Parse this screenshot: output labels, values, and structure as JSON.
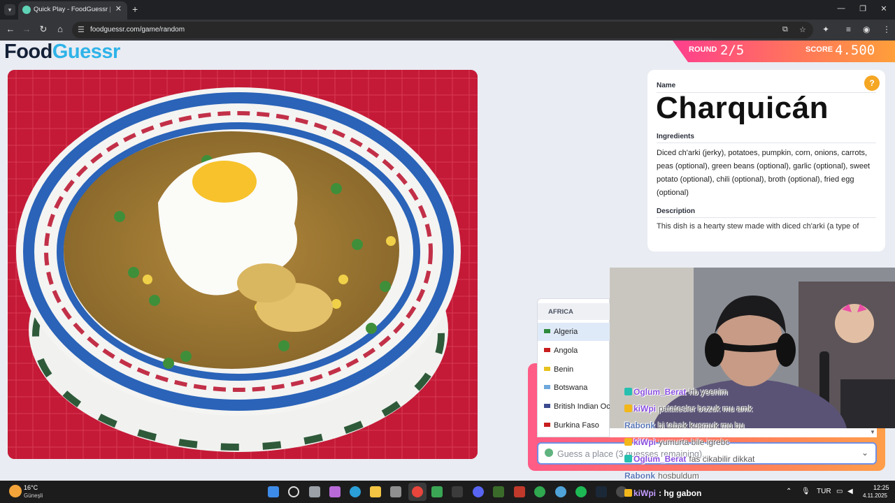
{
  "browser": {
    "tab_title": "Quick Play - FoodGuessr | Food",
    "url": "foodguessr.com/game/random"
  },
  "logo": {
    "part1": "Food",
    "part2": "Guessr"
  },
  "status": {
    "round_label": "ROUND",
    "round_value": "2/5",
    "score_label": "SCORE",
    "score_value": "4.500"
  },
  "dish": {
    "name_label": "Name",
    "name": "Charquicán",
    "ingredients_label": "Ingredients",
    "ingredients": "Diced ch'arki (jerky), potatoes, pumpkin, corn, onions, carrots, peas (optional), green beans (optional), garlic (optional), sweet potato (optional), chili (optional), broth (optional), fried egg (optional)",
    "description_label": "Description",
    "description": "This dish is a hearty stew made with diced ch'arki (a type of"
  },
  "dropdown": {
    "group": "AFRICA",
    "items": [
      {
        "label": "Algeria",
        "selected": true,
        "flag": "#2e8b3c"
      },
      {
        "label": "Angola",
        "selected": false,
        "flag": "#c81e1e"
      },
      {
        "label": "Benin",
        "selected": false,
        "flag": "#e8c21e"
      },
      {
        "label": "Botswana",
        "selected": false,
        "flag": "#6fa8dc"
      },
      {
        "label": "British Indian Ocean Territory",
        "selected": false,
        "flag": "#3c4a8f"
      },
      {
        "label": "Burkina Faso",
        "selected": false,
        "flag": "#c81e1e"
      }
    ]
  },
  "guess_input": {
    "placeholder": "Guess a place (3 guesses remaining).."
  },
  "stream_chat": [
    {
      "user": "Oglum_Berat",
      "message": "hb yeenim",
      "color": "#8a4fe0"
    },
    {
      "user": "kiWpi",
      "message": "patatesler bozuk mu amk",
      "color": "#8a4fe0"
    },
    {
      "user": "Rabonk",
      "message": "bi tabak kusmuk mu bu",
      "color": "#5a78b8"
    },
    {
      "user": "kiWpi",
      "message": "yumurta bile igrebc",
      "color": "#8a4fe0"
    },
    {
      "user": "Oglum_Berat",
      "message": "fas cikabilir dikkat",
      "color": "#8a4fe0"
    },
    {
      "user": "Rabonk",
      "message": "hosbuldum",
      "color": "#5a78b8"
    },
    {
      "user": "kiWpi",
      "message": "hg gabon",
      "color": "#ffffff"
    }
  ],
  "taskbar": {
    "temp": "16°C",
    "weather": "Güneşli",
    "lang": "TUR",
    "time": "12:25",
    "date": "4.11.2025"
  },
  "colors": {
    "accent_blue": "#2fb3e8",
    "score_gradient_start": "#ff3e8e",
    "score_gradient_end": "#ff9f3a",
    "help": "#f5a623"
  }
}
